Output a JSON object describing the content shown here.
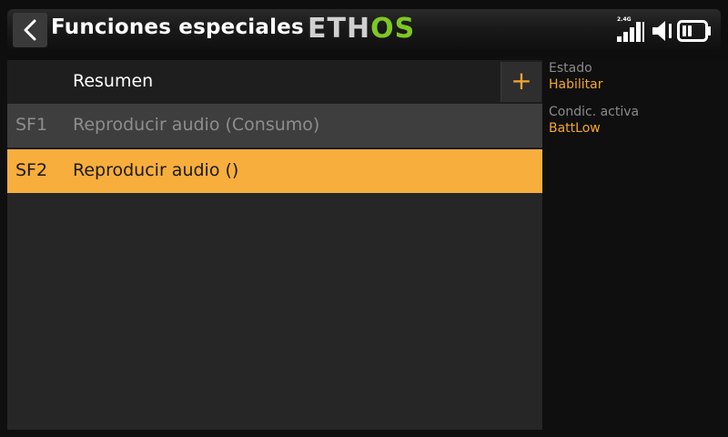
{
  "header": {
    "title": "Funciones especiales",
    "logo_left": "ETH",
    "logo_right": "OS",
    "rf_band": "2.4G"
  },
  "list": {
    "summary_label": "Resumen",
    "add_label": "+",
    "items": [
      {
        "code": "SF1",
        "description": "Reproducir audio (Consumo)",
        "state": "disabled"
      },
      {
        "code": "SF2",
        "description": "Reproducir audio ()",
        "state": "selected"
      }
    ]
  },
  "details": {
    "state_label": "Estado",
    "state_value": "Habilitar",
    "condition_label": "Condic. activa",
    "condition_value": "BattLow"
  },
  "colors": {
    "accent": "#f8ae3c",
    "logo_green": "#7dc823",
    "disabled_text": "#8d8d8d"
  },
  "icons": {
    "back": "chevron-left-icon",
    "signal": "signal-bars-icon",
    "audio": "speaker-muted-icon",
    "battery": "battery-icon"
  }
}
